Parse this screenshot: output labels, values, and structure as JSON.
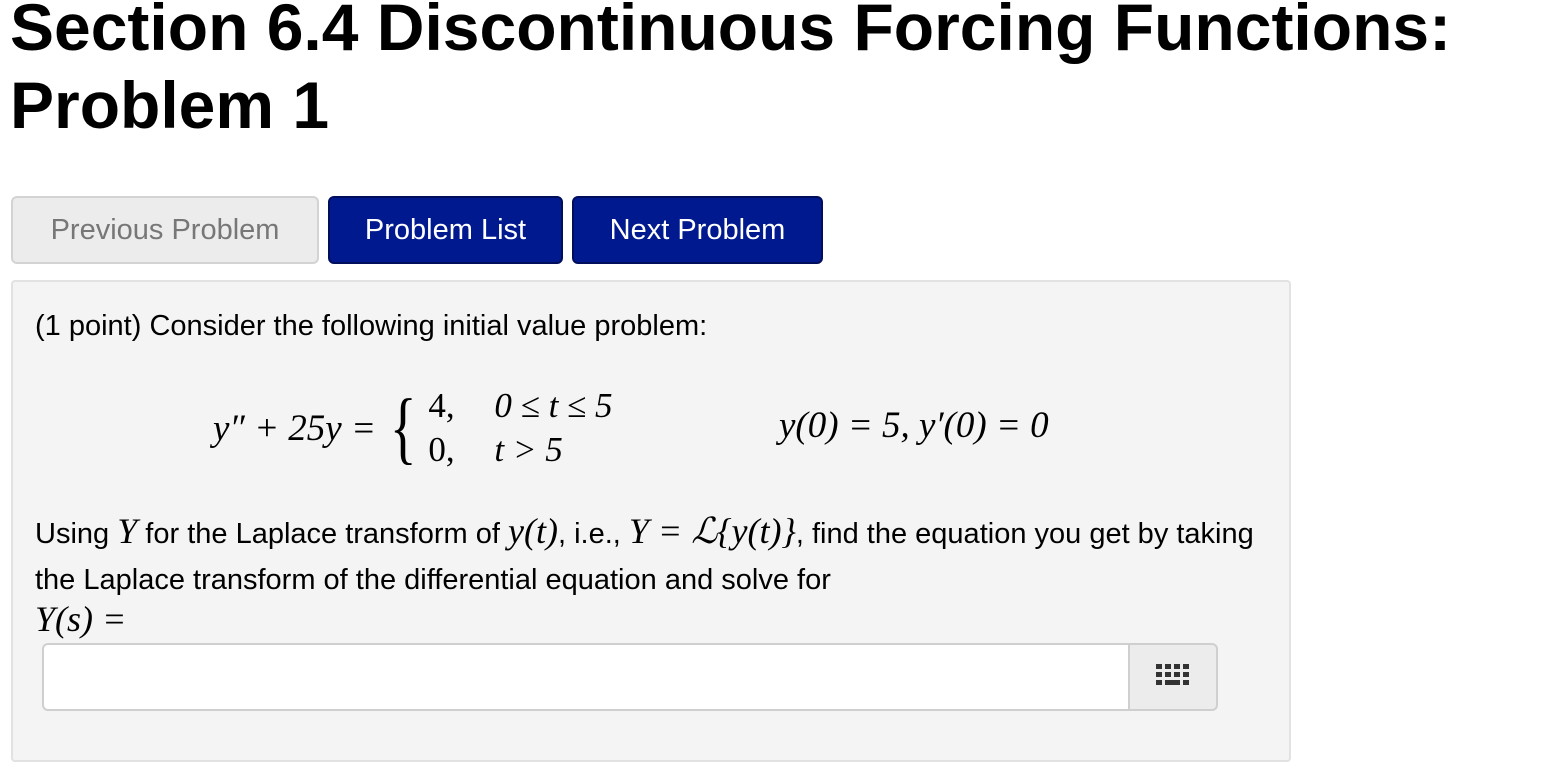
{
  "page": {
    "title_line1": "Section 6.4 Discontinuous Forcing Functions:",
    "title_line2": "Problem 1"
  },
  "nav": {
    "previous_label": "Previous Problem",
    "list_label": "Problem List",
    "next_label": "Next Problem"
  },
  "problem": {
    "intro": "(1 point) Consider the following initial value problem:",
    "equation": {
      "lhs": "y″ + 25y =",
      "cases": [
        {
          "value": "4,",
          "condition": "0 ≤ t ≤ 5"
        },
        {
          "value": "0,",
          "condition": "t > 5"
        }
      ]
    },
    "initial_conditions": "y(0) = 5,  y′(0) = 0",
    "instruction": {
      "t1": "Using ",
      "m1": "Y",
      "t2": " for the Laplace transform of ",
      "m2": "y(t)",
      "t3": ", i.e., ",
      "m3": "Y = ℒ{y(t)}",
      "t4": ", find the equation you get by taking the Laplace transform of the differential equation and solve for"
    },
    "answer_label": "Y(s) =",
    "answer_value": "",
    "keypad_icon": "grid-icon"
  }
}
